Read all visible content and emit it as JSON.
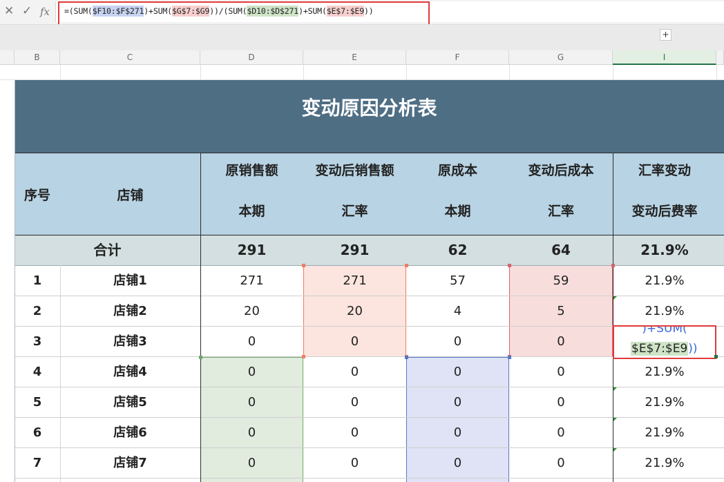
{
  "formula_bar": {
    "cancel_icon": "close-icon",
    "enter_icon": "check-icon",
    "fx_label": "fx",
    "segments": [
      {
        "text": "=(SUM(",
        "ref": false
      },
      {
        "text": "$F10:$F$271",
        "ref": true,
        "color": "blue"
      },
      {
        "text": ")+SUM(",
        "ref": false
      },
      {
        "text": "$G$7:$G9",
        "ref": true,
        "color": "red"
      },
      {
        "text": "))/(SUM(",
        "ref": false
      },
      {
        "text": "$D10:$D$271",
        "ref": true,
        "color": "green"
      },
      {
        "text": ")+SUM(",
        "ref": false
      },
      {
        "text": "$E$7:$E9",
        "ref": true,
        "color": "red"
      },
      {
        "text": "))",
        "ref": false
      }
    ],
    "expand_label": "+"
  },
  "columns": [
    "B",
    "C",
    "D",
    "E",
    "F",
    "G",
    "I"
  ],
  "sheet": {
    "title": "变动原因分析表",
    "headers": {
      "seq": "序号",
      "store": "店铺",
      "d_top": "原销售额",
      "d_bottom": "本期",
      "e_top": "变动后销售额",
      "e_bottom": "汇率",
      "f_top": "原成本",
      "f_bottom": "本期",
      "g_top": "变动后成本",
      "g_bottom": "汇率",
      "i_top": "汇率变动",
      "i_bottom": "变动后费率"
    },
    "total": {
      "label": "合计",
      "d": "291",
      "e": "291",
      "f": "62",
      "g": "64",
      "i": "21.9%"
    },
    "rows": [
      {
        "seq": "1",
        "store": "店铺1",
        "d": "271",
        "e": "271",
        "f": "57",
        "g": "59",
        "i": "21.9%"
      },
      {
        "seq": "2",
        "store": "店铺2",
        "d": "20",
        "e": "20",
        "f": "4",
        "g": "5",
        "i": "21.9%"
      },
      {
        "seq": "3",
        "store": "店铺3",
        "d": "0",
        "e": "0",
        "f": "0",
        "g": "0",
        "i": ""
      },
      {
        "seq": "4",
        "store": "店铺4",
        "d": "0",
        "e": "0",
        "f": "0",
        "g": "0",
        "i": "21.9%"
      },
      {
        "seq": "5",
        "store": "店铺5",
        "d": "0",
        "e": "0",
        "f": "0",
        "g": "0",
        "i": "21.9%"
      },
      {
        "seq": "6",
        "store": "店铺6",
        "d": "0",
        "e": "0",
        "f": "0",
        "g": "0",
        "i": "21.9%"
      },
      {
        "seq": "7",
        "store": "店铺7",
        "d": "0",
        "e": "0",
        "f": "0",
        "g": "0",
        "i": "21.9%"
      }
    ],
    "editing_cell": {
      "line1_prefix": ")+SUM(",
      "line2_ref": "$E$7:$E9",
      "line2_suffix": "))"
    }
  },
  "colors": {
    "title_bg": "#4e6e84",
    "header_bg": "#b8d3e3",
    "total_bg": "#d3dfe0",
    "ref_blue": "#c7d3f2",
    "ref_red": "#f7cfcf",
    "ref_green": "#cfe4c7",
    "highlight_red": "#e23b3b"
  }
}
